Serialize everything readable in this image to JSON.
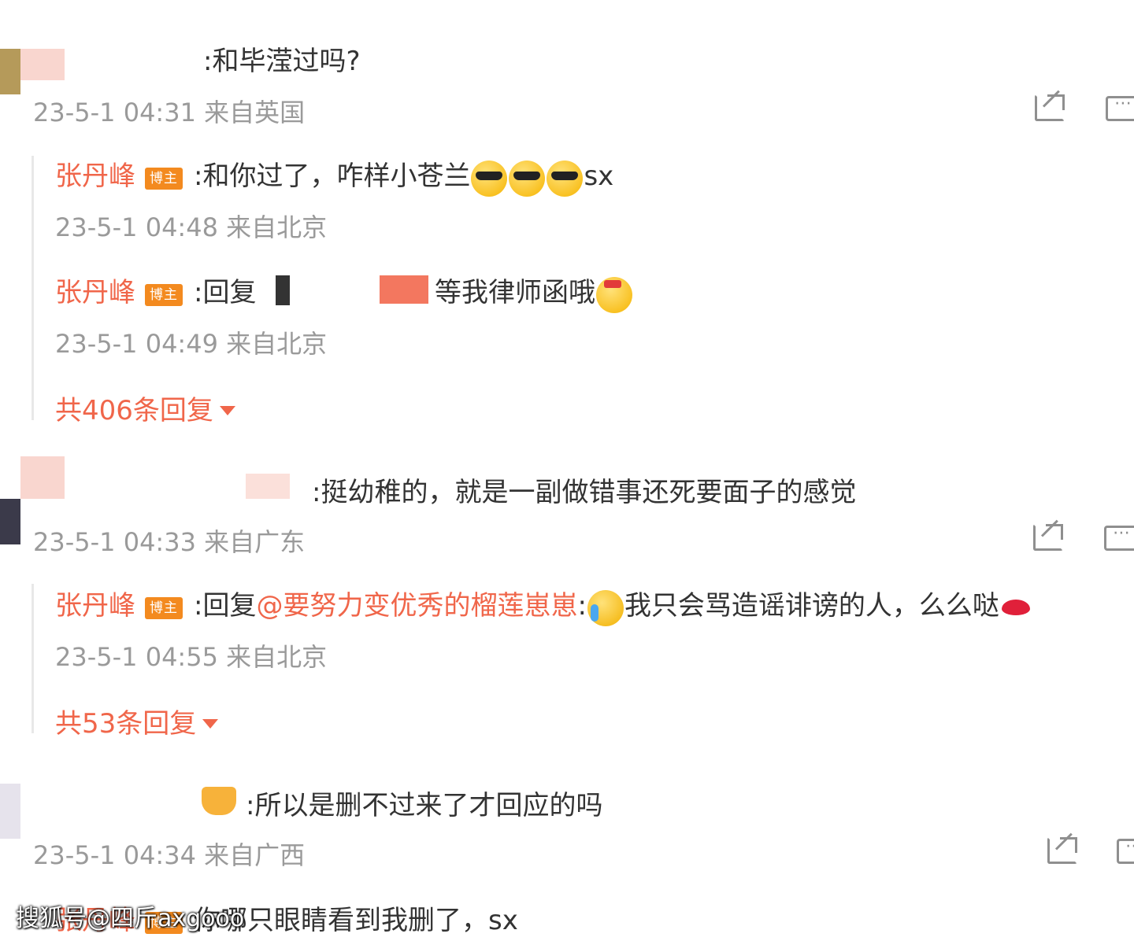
{
  "comments": [
    {
      "text": ":和毕滢过吗?",
      "meta": "23-5-1 04:31 来自英国",
      "replies": [
        {
          "author": "张丹峰",
          "badge": "博主",
          "text": ":和你过了，咋样小苍兰",
          "emoji": [
            "sunglasses",
            "sunglasses",
            "sunglasses"
          ],
          "suffix": "sx",
          "meta": "23-5-1 04:48 来自北京"
        },
        {
          "author": "张丹峰",
          "badge": "博主",
          "prefix": ":回复",
          "text": "等我律师函哦",
          "emoji": [
            "shy"
          ],
          "meta": "23-5-1 04:49 来自北京"
        }
      ],
      "more_replies": "共406条回复"
    },
    {
      "text": ":挺幼稚的，就是一副做错事还死要面子的感觉",
      "meta": "23-5-1 04:33 来自广东",
      "replies": [
        {
          "author": "张丹峰",
          "badge": "博主",
          "prefix": ":回复",
          "mention": "@要努力变优秀的榴莲崽崽",
          "text": "我只会骂造谣诽谤的人，么么哒",
          "emoji": [
            "laugh-cry",
            "lips"
          ],
          "meta": "23-5-1 04:55 来自北京"
        }
      ],
      "more_replies": "共53条回复"
    },
    {
      "text": ":所以是删不过来了才回应的吗",
      "meta": "23-5-1 04:34 来自广西",
      "replies": [
        {
          "author": "张丹峰",
          "badge": "博主",
          "text": "你哪只眼睛看到我删了，sx"
        }
      ]
    }
  ],
  "watermark": "搜狐号@四斤axgooo",
  "icons": {
    "share": "share-icon",
    "comment": "comment-icon"
  },
  "colors": {
    "name": "#f0664a",
    "badge": "#f38a1f",
    "meta": "#9a9a9a",
    "text": "#333333"
  }
}
